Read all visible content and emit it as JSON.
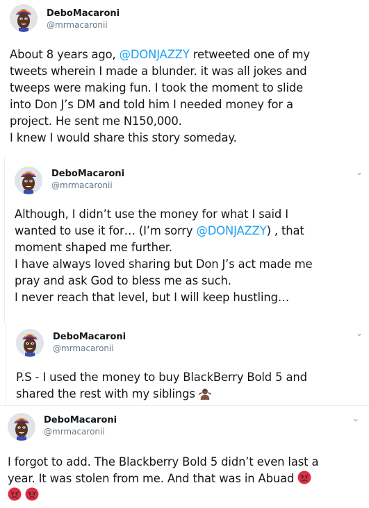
{
  "tweets": [
    {
      "name": "DeboMacaroni",
      "handle": "@mrmacaronii",
      "lines": [
        [
          "About 8 years ago, ",
          "@DONJAZZY",
          " retweeted one of my"
        ],
        [
          "tweets wherein I made a blunder. it was all jokes and"
        ],
        [
          "tweeps were making fun. I took the moment to slide"
        ],
        [
          "into Don J’s DM and told him I needed money for a"
        ],
        [
          "project. He sent me N150,000."
        ],
        [
          "I knew I would share this story someday."
        ]
      ]
    },
    {
      "name": "DeboMacaroni",
      "handle": "@mrmacaronii",
      "lines": [
        [
          "Although, I didn’t use the money for what I said I"
        ],
        [
          "wanted to use it for… (I’m sorry ",
          "@DONJAZZY",
          ") , that"
        ],
        [
          "moment shaped me further."
        ],
        [
          "I have always loved sharing but Don J’s act made me"
        ],
        [
          "pray and ask God to bless me as such."
        ],
        [
          "I never reach that level, but I will keep hustling…"
        ]
      ]
    },
    {
      "name": "DeboMacaroni",
      "handle": "@mrmacaronii",
      "lines": [
        [
          "P.S - I used the money to buy BlackBerry Bold 5 and"
        ],
        [
          "shared the rest with my siblings "
        ]
      ]
    },
    {
      "name": "DeboMacaroni",
      "handle": "@mrmacaronii",
      "lines": [
        [
          "I forgot to add. The Blackberry Bold 5 didn’t even last a"
        ],
        [
          "year. It was stolen from me. And that was in Abuad "
        ]
      ]
    }
  ],
  "colors": {
    "mention": "#1da1f2",
    "handle": "#657786",
    "angry_emoji": "#dd2e44",
    "shrug_skin": "#7c533e"
  },
  "icons": [
    "chevron-down-icon",
    "angry-face-icon",
    "person-shrugging-icon"
  ]
}
